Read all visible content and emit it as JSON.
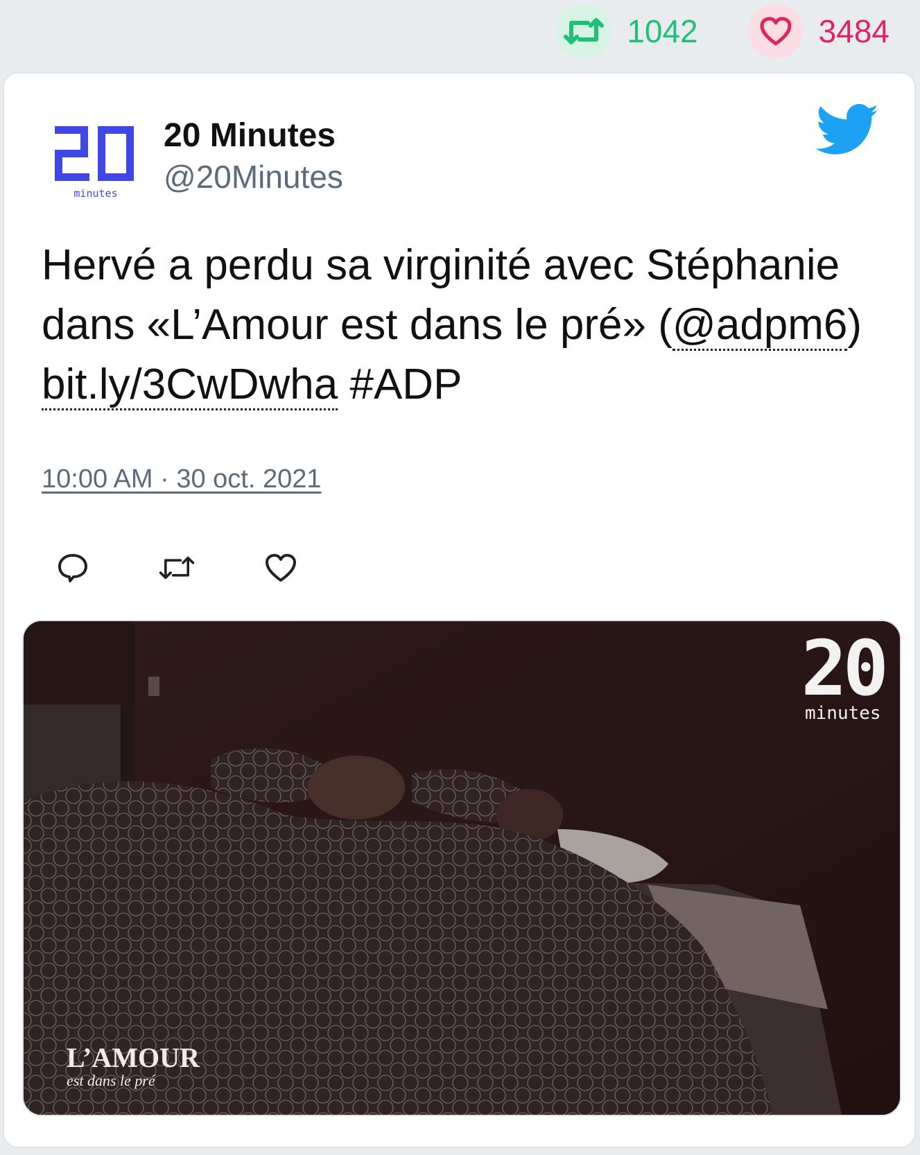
{
  "stats": {
    "retweets": "1042",
    "likes": "3484",
    "retweet_color": "#1fbf7a",
    "like_color": "#e0245e"
  },
  "tweet": {
    "author_name": "20 Minutes",
    "author_handle": "@20Minutes",
    "avatar_digits": "20",
    "avatar_word": "minutes",
    "text_part1": "Hervé a perdu sa virginité avec Stéphanie dans «L’Amour est dans le pré» (",
    "mention": "@adpm6",
    "text_part2": ") ",
    "link": "bit.ly/3CwDwha",
    "hashtag": " #ADP",
    "timestamp": "10:00 AM · 30 oct. 2021",
    "icons": {
      "reply": "reply-icon",
      "retweet": "retweet-icon",
      "like": "heart-icon",
      "brand": "twitter-bird-icon"
    }
  },
  "media": {
    "watermark_digits": "20",
    "watermark_word": "minutes",
    "show_title": "L’AMOUR",
    "show_subtitle": "est dans le pré"
  }
}
